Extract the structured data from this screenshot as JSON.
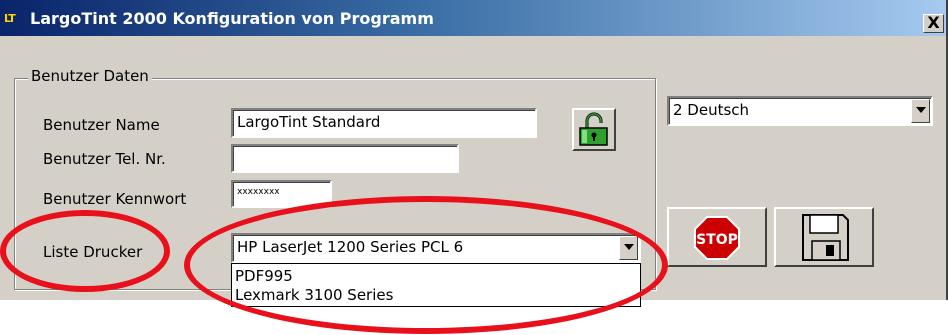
{
  "window": {
    "title": "LargoTint 2000 Konfiguration von Programm",
    "app_icon_text": "LT",
    "close_label": "X"
  },
  "group": {
    "title": "Benutzer Daten"
  },
  "fields": {
    "name_label": "Benutzer Name",
    "name_value": "LargoTint Standard",
    "phone_label": "Benutzer Tel. Nr.",
    "phone_value": "",
    "password_label": "Benutzer Kennwort",
    "password_value": "xxxxxxxx",
    "printer_label": "Liste Drucker",
    "printer_selected": "HP LaserJet 1200 Series PCL 6"
  },
  "printer_options": [
    "PDF995",
    "Lexmark 3100 Series"
  ],
  "language": {
    "selected": "2 Deutsch"
  },
  "buttons": {
    "stop_label": "STOP"
  },
  "colors": {
    "annotation": "#e8101a",
    "lock_green": "#2ea02e",
    "stop_red": "#cc0000"
  }
}
